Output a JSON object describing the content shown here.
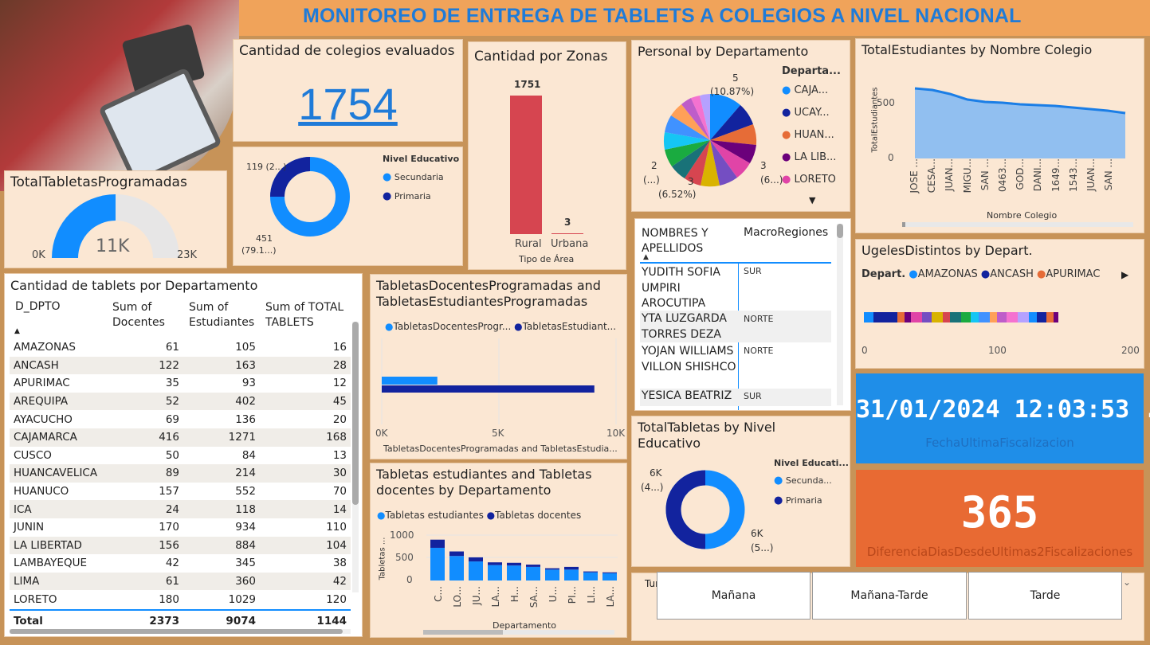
{
  "page_title": "MONITOREO DE ENTREGA DE TABLETS A COLEGIOS A NIVEL NACIONAL",
  "kpi_colegios": {
    "title": "Cantidad de colegios evaluados",
    "value": "1754"
  },
  "gauge": {
    "title": "TotalTabletasProgramadas",
    "value": "11K",
    "min": "0K",
    "max": "23K",
    "fraction": 0.5
  },
  "donut_nivel": {
    "legend_title": "Nivel Educativo",
    "items": [
      {
        "label": "Secundaria",
        "color": "#118dff"
      },
      {
        "label": "Primaria",
        "color": "#12239e"
      }
    ],
    "label_top": "119 (2...)",
    "label_bottom_1": "451",
    "label_bottom_2": "(79.1...)"
  },
  "zonas": {
    "title": "Cantidad por Zonas",
    "xlabel": "Tipo de Área",
    "bars": [
      {
        "label": "Rural",
        "value": "1751"
      },
      {
        "label": "Urbana",
        "value": "3"
      }
    ]
  },
  "personal": {
    "title": "Personal by Departamento",
    "legend_title": "Departa...",
    "legend": [
      {
        "label": "CAJA...",
        "color": "#118dff"
      },
      {
        "label": "UCAY...",
        "color": "#12239e"
      },
      {
        "label": "HUAN...",
        "color": "#e66c37"
      },
      {
        "label": "LA LIB...",
        "color": "#6b007b"
      },
      {
        "label": "LORETO",
        "color": "#e044a7"
      }
    ],
    "lbl_a_1": "5",
    "lbl_a_2": "(10.87%)",
    "lbl_b_1": "2",
    "lbl_b_2": "(...)",
    "lbl_c_1": "3",
    "lbl_c_2": "(6.52%)",
    "lbl_d_1": "3",
    "lbl_d_2": "(6...)"
  },
  "estudiantes_colegio": {
    "title": "TotalEstudiantes by Nombre Colegio",
    "ylabel": "TotalEstudiantes",
    "xlabel": "Nombre Colegio",
    "yticks": [
      "500",
      "0"
    ],
    "categories": [
      "JOSE ...",
      "CESA...",
      "JUAN...",
      "MIGU...",
      "SAN ...",
      "0463...",
      "GOD...",
      "DANI...",
      "1649...",
      "1543...",
      "JUAN...",
      "SAN ..."
    ]
  },
  "personas_table": {
    "col1": "NOMBRES Y APELLIDOS",
    "col2": "MacroRegiones",
    "rows": [
      {
        "name": "YUDITH SOFIA UMPIRI AROCUTIPA",
        "region": "SUR"
      },
      {
        "name": "YTA LUZGARDA TORRES DEZA",
        "region": "NORTE"
      },
      {
        "name": "YOJAN WILLIAMS VILLON SHISHCO",
        "region": "NORTE"
      },
      {
        "name": "YESICA BEATRIZ",
        "region": "SUR"
      }
    ]
  },
  "ugeles": {
    "title": "UgelesDistintos by Depart.",
    "legend_title": "Depart.",
    "legend": [
      {
        "label": "AMAZONAS",
        "color": "#118dff"
      },
      {
        "label": "ANCASH",
        "color": "#12239e"
      },
      {
        "label": "APURIMAC",
        "color": "#e66c37"
      }
    ],
    "ticks": [
      "0",
      "100",
      "200"
    ]
  },
  "depto_table": {
    "title": "Cantidad de tablets por Departamento",
    "headers": [
      "D_DPTO",
      "Sum of Docentes",
      "Sum of Estudiantes",
      "Sum of TOTAL TABLETS"
    ],
    "rows": [
      [
        "AMAZONAS",
        "61",
        "105",
        "16"
      ],
      [
        "ANCASH",
        "122",
        "163",
        "28"
      ],
      [
        "APURIMAC",
        "35",
        "93",
        "12"
      ],
      [
        "AREQUIPA",
        "52",
        "402",
        "45"
      ],
      [
        "AYACUCHO",
        "69",
        "136",
        "20"
      ],
      [
        "CAJAMARCA",
        "416",
        "1271",
        "168"
      ],
      [
        "CUSCO",
        "50",
        "84",
        "13"
      ],
      [
        "HUANCAVELICA",
        "89",
        "214",
        "30"
      ],
      [
        "HUANUCO",
        "157",
        "552",
        "70"
      ],
      [
        "ICA",
        "24",
        "118",
        "14"
      ],
      [
        "JUNIN",
        "170",
        "934",
        "110"
      ],
      [
        "LA LIBERTAD",
        "156",
        "884",
        "104"
      ],
      [
        "LAMBAYEQUE",
        "42",
        "345",
        "38"
      ],
      [
        "LIMA",
        "61",
        "360",
        "42"
      ],
      [
        "LORETO",
        "180",
        "1029",
        "120"
      ]
    ],
    "total": [
      "Total",
      "2373",
      "9074",
      "1144"
    ]
  },
  "tabletas_prog": {
    "title_1": "TabletasDocentesProgramadas and",
    "title_2": "TabletasEstudiantesProgramadas",
    "legend": [
      {
        "label": "TabletasDocentesProgr...",
        "color": "#118dff"
      },
      {
        "label": "TabletasEstudiant...",
        "color": "#12239e"
      }
    ],
    "ticks": [
      "0K",
      "5K",
      "10K"
    ],
    "xlabel": "TabletasDocentesProgramadas and TabletasEstudia...",
    "chart_data": {
      "type": "bar",
      "series": [
        {
          "name": "TabletasDocentesProgr...",
          "values": [
            2373
          ]
        },
        {
          "name": "TabletasEstudiant...",
          "values": [
            9074
          ]
        }
      ],
      "xlim": [
        0,
        10000
      ]
    }
  },
  "tabletas_depto": {
    "title_1": "Tabletas estudiantes and Tabletas",
    "title_2": "docentes by Departamento",
    "legend": [
      {
        "label": "Tabletas estudiantes",
        "color": "#118dff"
      },
      {
        "label": "Tabletas docentes",
        "color": "#12239e"
      }
    ],
    "yticks": [
      "1000",
      "500",
      "0"
    ],
    "ylabel": "Tabletas ...",
    "xlabel": "Departamento",
    "chart_data": {
      "type": "bar",
      "categories": [
        "C...",
        "LO...",
        "JU...",
        "LA...",
        "H...",
        "SA...",
        "U...",
        "PI...",
        "LI...",
        "LA..."
      ],
      "series": [
        {
          "name": "Tabletas estudiantes",
          "values": [
            720,
            540,
            420,
            340,
            330,
            300,
            240,
            240,
            180,
            160
          ]
        },
        {
          "name": "Tabletas docentes",
          "values": [
            180,
            100,
            90,
            60,
            60,
            50,
            30,
            60,
            20,
            20
          ]
        }
      ],
      "ylim": [
        0,
        1000
      ]
    }
  },
  "tabletas_nivel": {
    "title_1": "TotalTabletas by Nivel",
    "title_2": "Educativo",
    "legend_title": "Nivel Educati...",
    "legend": [
      {
        "label": "Secunda...",
        "color": "#118dff"
      },
      {
        "label": "Primaria",
        "color": "#12239e"
      }
    ],
    "label_top_1": "6K",
    "label_top_2": "(4...)",
    "label_bottom_1": "6K",
    "label_bottom_2": "(5...)"
  },
  "fecha": {
    "value": "31/01/2024 12:03:53 ...",
    "label": "FechaUltimaFiscalizacion"
  },
  "dias": {
    "value": "365",
    "label": "DiferenciaDiasDesdeUltimas2Fiscalizaciones"
  },
  "turno": {
    "title": "Turno de la IEE",
    "options": [
      "Mañana",
      "Mañana-Tarde",
      "Tarde"
    ]
  }
}
